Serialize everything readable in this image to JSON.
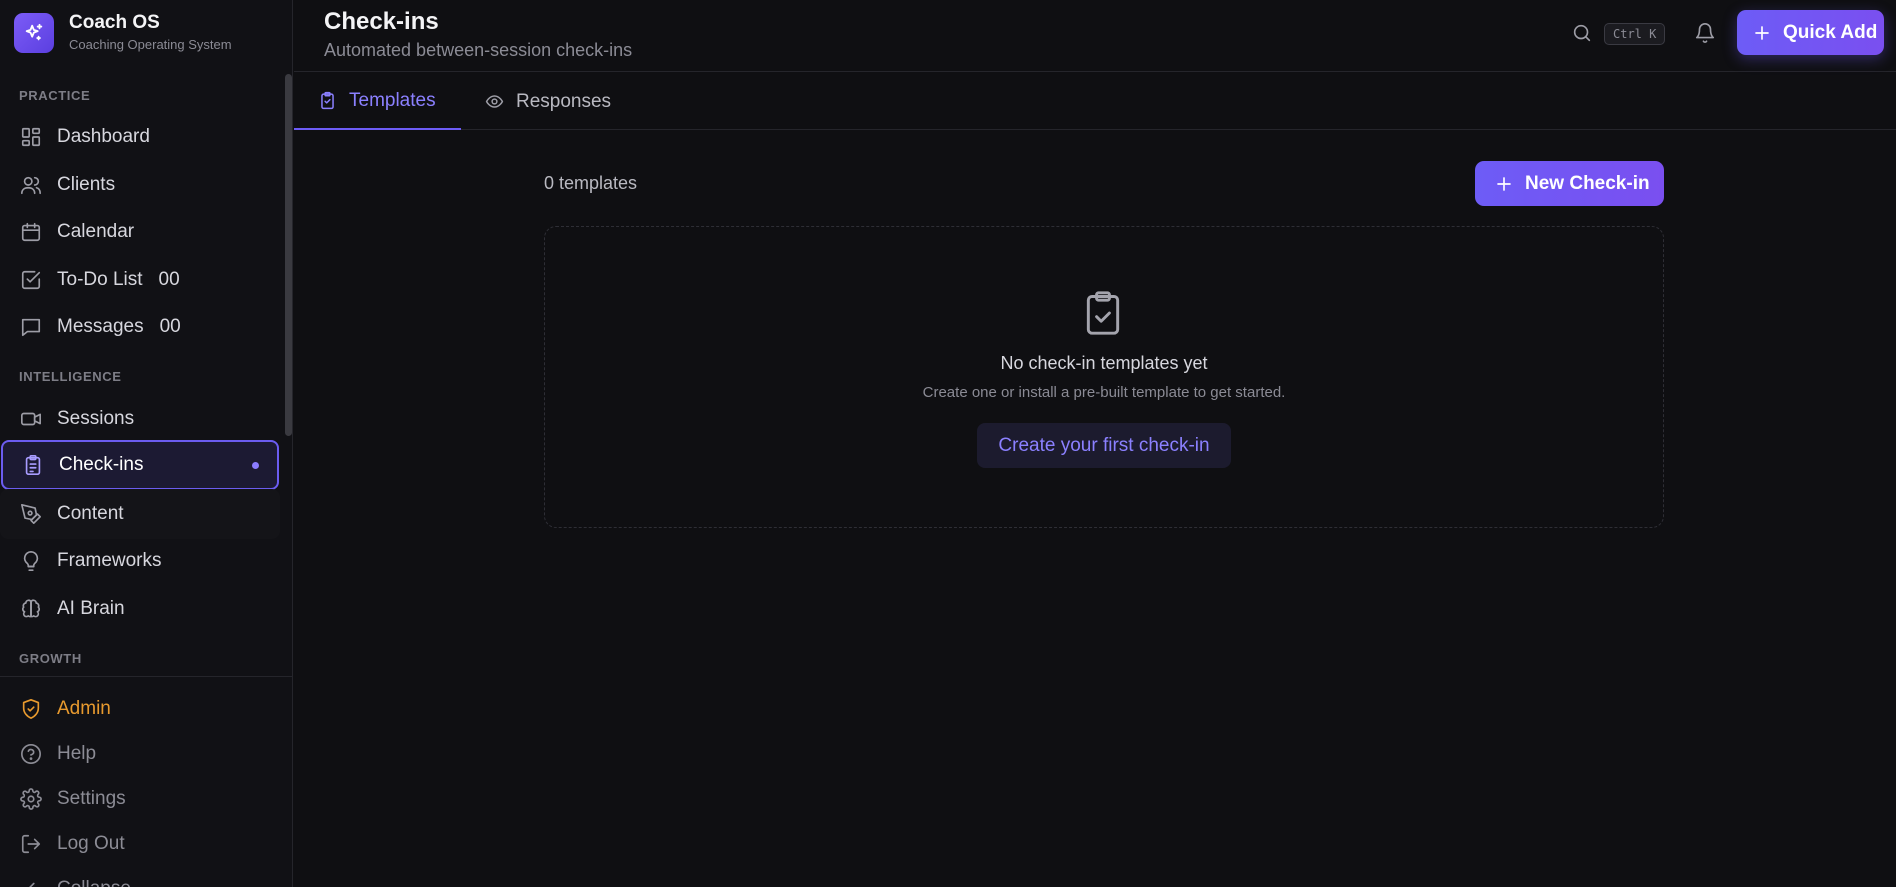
{
  "brand": {
    "title": "Coach OS",
    "subtitle": "Coaching Operating System"
  },
  "sidebar": {
    "sections": [
      {
        "label": "PRACTICE"
      },
      {
        "label": "INTELLIGENCE"
      },
      {
        "label": "GROWTH"
      }
    ],
    "items": [
      {
        "label": "Dashboard",
        "icon": "dashboard-icon"
      },
      {
        "label": "Clients",
        "icon": "users-icon"
      },
      {
        "label": "Calendar",
        "icon": "calendar-icon"
      },
      {
        "label": "To-Do List",
        "icon": "checkbox-icon",
        "count": "00"
      },
      {
        "label": "Messages",
        "icon": "message-icon",
        "count": "00"
      },
      {
        "label": "Sessions",
        "icon": "video-icon"
      },
      {
        "label": "Check-ins",
        "icon": "clipboard-check-icon",
        "active": true
      },
      {
        "label": "Content",
        "icon": "pen-tool-icon"
      },
      {
        "label": "Frameworks",
        "icon": "lightbulb-icon"
      },
      {
        "label": "AI Brain",
        "icon": "brain-icon"
      }
    ],
    "bottom": [
      {
        "label": "Admin",
        "icon": "shield-icon"
      },
      {
        "label": "Help",
        "icon": "help-circle-icon"
      },
      {
        "label": "Settings",
        "icon": "gear-icon"
      },
      {
        "label": "Log Out",
        "icon": "logout-icon"
      },
      {
        "label": "Collapse",
        "icon": "chevron-left-icon"
      }
    ]
  },
  "header": {
    "title": "Check-ins",
    "subtitle": "Automated between-session check-ins",
    "shortcut": "Ctrl K",
    "quick_add_label": "Quick Add"
  },
  "tabs": [
    {
      "label": "Templates",
      "icon": "clipboard-check-icon",
      "active": true
    },
    {
      "label": "Responses",
      "icon": "eye-icon"
    }
  ],
  "main": {
    "count_label": "0 templates",
    "new_button_label": "New Check-in",
    "empty": {
      "title": "No check-in templates yet",
      "description": "Create one or install a pre-built template to get started.",
      "button_label": "Create your first check-in"
    }
  },
  "colors": {
    "accent": "#6d5cf6",
    "accent_text": "#8b80ff",
    "admin": "#e89a2e",
    "background": "#0f0f12"
  }
}
